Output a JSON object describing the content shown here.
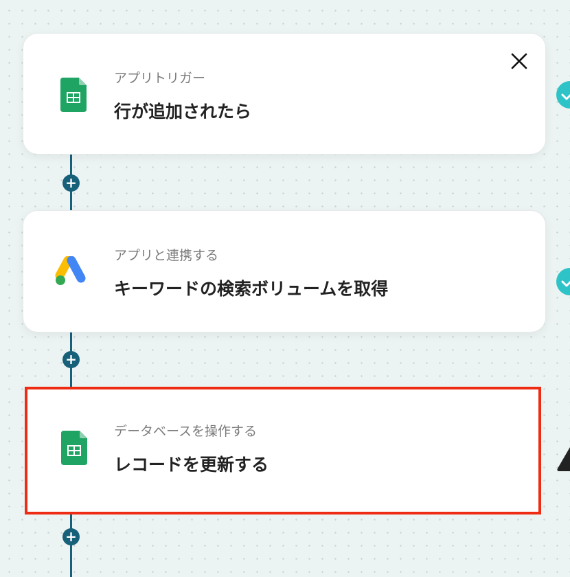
{
  "flow": {
    "steps": [
      {
        "subtitle": "アプリトリガー",
        "title": "行が追加されたら",
        "icon": "google-sheets-icon",
        "status": "check-icon"
      },
      {
        "subtitle": "アプリと連携する",
        "title": "キーワードの検索ボリュームを取得",
        "icon": "google-ads-icon",
        "status": "check-icon"
      },
      {
        "subtitle": "データベースを操作する",
        "title": "レコードを更新する",
        "icon": "google-sheets-icon",
        "status": "warning-icon",
        "selected": true
      }
    ],
    "add_step_label": "+",
    "close_icon": "close-icon"
  },
  "colors": {
    "connector": "#17607a",
    "highlight": "#ee2c14",
    "status_ok": "#2ec3c6",
    "sheets_green": "#1fa463",
    "ads_blue": "#4285f4",
    "ads_yellow": "#fbbc04",
    "ads_green": "#34a853"
  }
}
